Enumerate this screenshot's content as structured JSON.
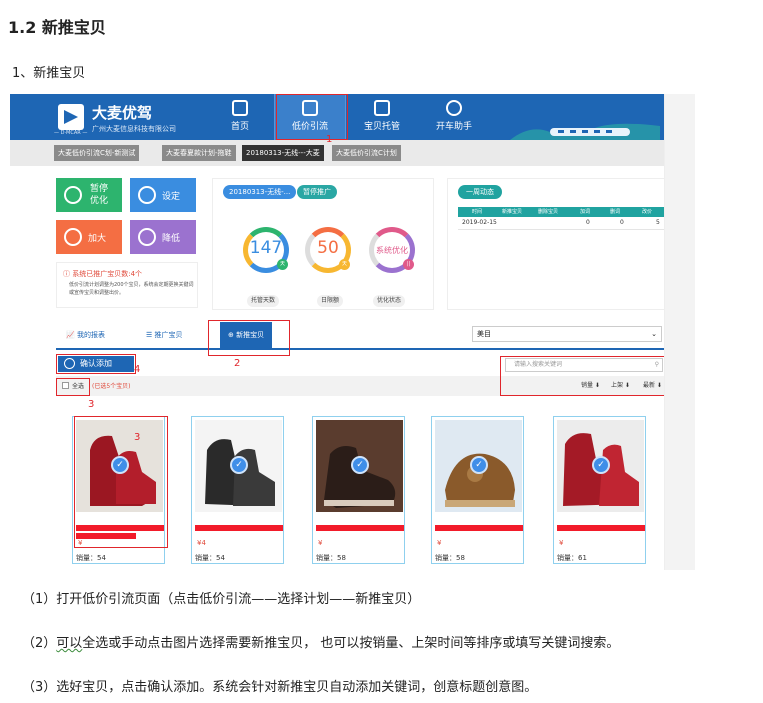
{
  "doc": {
    "heading": "1.2 新推宝贝",
    "subheading": "1、新推宝贝",
    "steps": [
      "（1）打开低价引流页面（点击低价引流——选择计划——新推宝贝）",
      "（3）选好宝贝，点击确认添加。系统会针对新推宝贝自动添加关键词，创意标题创意图。"
    ],
    "step2": {
      "prefix": "（2）",
      "wavy": "可以",
      "rest": "全选或手动点击图片选择需要新推宝贝， 也可以按销量、上架时间等排序或填写关键词搜索。"
    }
  },
  "app": {
    "brand_name": "大麦优驾",
    "brand_company": "广州大麦信息科技有限公司",
    "brand_tag": "— D·MCAR —",
    "nav": [
      "首页",
      "低价引流",
      "宝贝托管",
      "开车助手"
    ],
    "plans": [
      "大麦低价引流C划-新测试",
      "大麦春夏款计划-拖鞋",
      "20180313-无线---大麦",
      "大麦低价引流C计划"
    ],
    "buttons": {
      "pause": [
        "暂停",
        "优化"
      ],
      "settings": "设定",
      "increase": "加大",
      "decrease": "降低"
    },
    "alert_title": "系统已推广宝贝数:4个",
    "alert_desc": "低价引流计划调整为200个宝贝，系统会定期更换关键词或宣传宝贝和调整出价。",
    "plan_pill": "20180313-无线-...",
    "status_pill": "暂停推广",
    "gauges": [
      {
        "value": "147",
        "badge": "天",
        "label": "托管天数"
      },
      {
        "value": "50",
        "badge": "天",
        "label": "日限额"
      },
      {
        "value": "系统优化",
        "badge": "||",
        "label": "优化状态"
      }
    ],
    "week_title": "一周动态",
    "week_headers": [
      "时间",
      "新推宝贝",
      "删除宝贝",
      "加词",
      "删词",
      "改价"
    ],
    "week_row": [
      "2019-02-15",
      "",
      "",
      "0",
      "0",
      "5"
    ],
    "subtabs": [
      "我的报表",
      "推广宝贝",
      "新推宝贝"
    ],
    "category": "美目",
    "confirm": "确认添加",
    "search_placeholder": "请输入搜索关键词",
    "select_all": "全选",
    "selected_note": "(已选5个宝贝)",
    "sorts": [
      "销量 ⬇",
      "上架 ⬇",
      "最新 ⬇"
    ],
    "products": [
      {
        "price": "¥",
        "sales": "销量：54"
      },
      {
        "price": "¥4",
        "sales": "销量：54"
      },
      {
        "price": "¥",
        "sales": "销量：58"
      },
      {
        "price": "¥",
        "sales": "销量：58"
      },
      {
        "price": "¥",
        "sales": "销量：61"
      }
    ],
    "annotations": [
      "1",
      "2",
      "3",
      "3",
      "4"
    ]
  },
  "colors": {
    "brand_blue": "#1e66b4",
    "green": "#2db46e",
    "orange": "#f46e43",
    "purple": "#9b72cf",
    "teal": "#20a3a0",
    "red_annotation": "#e0262c"
  }
}
